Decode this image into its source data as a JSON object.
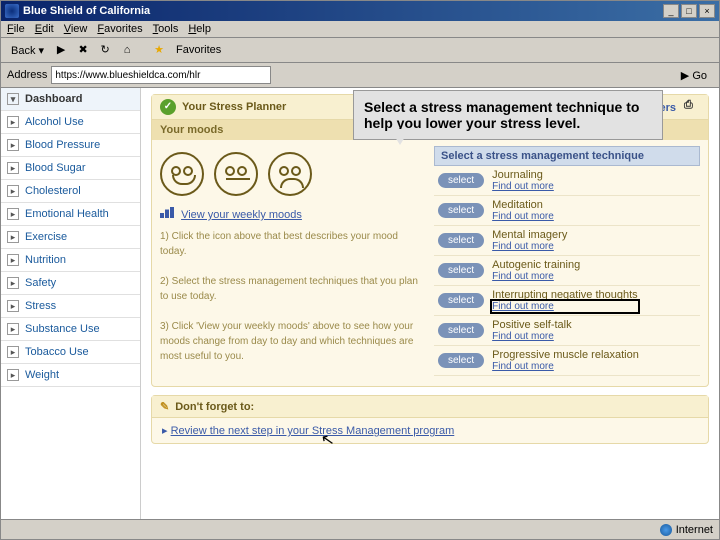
{
  "window": {
    "title": "Blue Shield of California"
  },
  "menubar": [
    "File",
    "Edit",
    "View",
    "Favorites",
    "Tools",
    "Help"
  ],
  "toolbar": {
    "back": "Back",
    "favorites": "Favorites"
  },
  "addressbar": {
    "label": "Address",
    "url": "https://www.blueshieldca.com/hlr",
    "go": "Go"
  },
  "sidebar": {
    "items": [
      {
        "label": "Dashboard",
        "active": true
      },
      {
        "label": "Alcohol Use"
      },
      {
        "label": "Blood Pressure"
      },
      {
        "label": "Blood Sugar"
      },
      {
        "label": "Cholesterol"
      },
      {
        "label": "Emotional Health"
      },
      {
        "label": "Exercise"
      },
      {
        "label": "Nutrition"
      },
      {
        "label": "Safety"
      },
      {
        "label": "Stress"
      },
      {
        "label": "Substance Use"
      },
      {
        "label": "Tobacco Use"
      },
      {
        "label": "Weight"
      }
    ]
  },
  "planner": {
    "title": "Your Stress Planner",
    "view_planners": "View Planners",
    "moods_heading": "Your moods",
    "weekly_link": "View your weekly moods",
    "step1": "1) Click the icon above that best describes your mood today.",
    "step2": "2) Select the stress management techniques that you plan to use today.",
    "step3": "3) Click 'View your weekly moods' above to see how your moods change from day to day and which techniques are most useful to you.",
    "tech_heading": "Select a stress management technique",
    "select_label": "select",
    "findout_label": "Find out more",
    "techniques": [
      {
        "name": "Journaling"
      },
      {
        "name": "Meditation"
      },
      {
        "name": "Mental imagery"
      },
      {
        "name": "Autogenic training"
      },
      {
        "name": "Interrupting negative thoughts",
        "highlight": true
      },
      {
        "name": "Positive self-talk"
      },
      {
        "name": "Progressive muscle relaxation"
      }
    ]
  },
  "forget": {
    "heading": "Don't forget to:",
    "link": "Review the next step in your Stress Management program"
  },
  "callout": "Select a stress management technique to help you lower your stress level.",
  "statusbar": {
    "zone": "Internet"
  }
}
